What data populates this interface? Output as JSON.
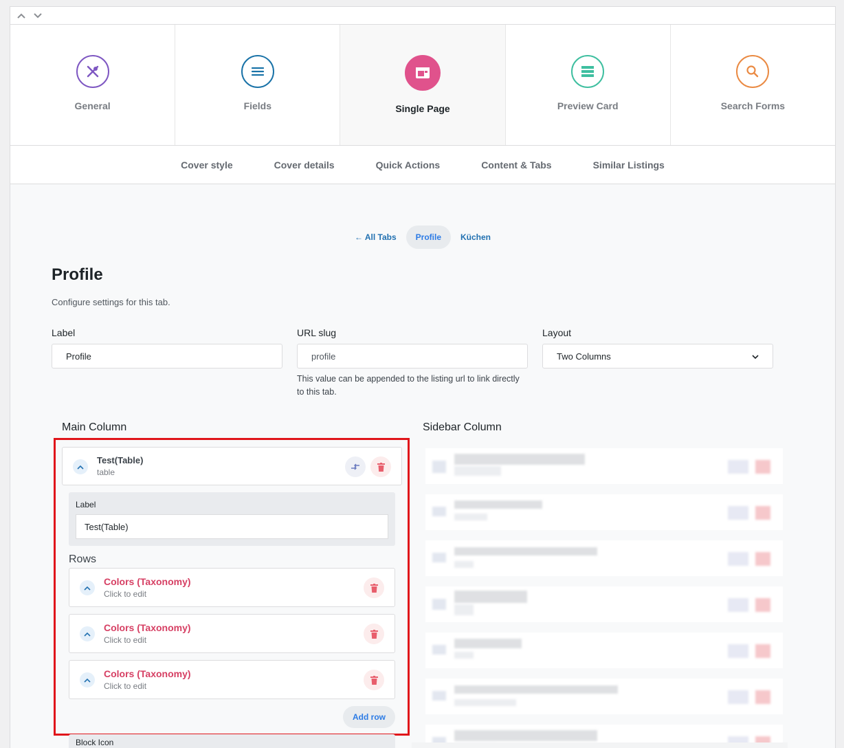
{
  "collapse_controls": {
    "up_icon": "chevron-up-icon",
    "down_icon": "chevron-down-icon"
  },
  "main_nav": [
    {
      "label": "General",
      "icon": "utensils-icon",
      "color": "#7e57c2",
      "active": false
    },
    {
      "label": "Fields",
      "icon": "list-lines-icon",
      "color": "#1a73a8",
      "active": false
    },
    {
      "label": "Single Page",
      "icon": "browser-window-icon",
      "color": "#e0528c",
      "active": true
    },
    {
      "label": "Preview Card",
      "icon": "card-icon",
      "color": "#3fbfa0",
      "active": false
    },
    {
      "label": "Search Forms",
      "icon": "search-icon",
      "color": "#ea8a43",
      "active": false
    }
  ],
  "sub_nav": [
    "Cover style",
    "Cover details",
    "Quick Actions",
    "Content & Tabs",
    "Similar Listings"
  ],
  "tab_bar": {
    "back": "← All Tabs",
    "current": "Profile",
    "next": "Küchen"
  },
  "page": {
    "title": "Profile",
    "description": "Configure settings for this tab."
  },
  "form": {
    "label_label": "Label",
    "label_value": "Profile",
    "slug_label": "URL slug",
    "slug_value": "profile",
    "slug_help": "This value can be appended to the listing url to link directly to this tab.",
    "layout_label": "Layout",
    "layout_value": "Two Columns"
  },
  "main_column": {
    "title": "Main Column",
    "block": {
      "title": "Test(Table)",
      "type": "table",
      "label_field_label": "Label",
      "label_field_value": "Test(Table)",
      "rows_title": "Rows",
      "rows": [
        {
          "title": "Colors (Taxonomy)",
          "sub": "Click to edit"
        },
        {
          "title": "Colors (Taxonomy)",
          "sub": "Click to edit"
        },
        {
          "title": "Colors (Taxonomy)",
          "sub": "Click to edit"
        }
      ],
      "add_row_label": "Add row",
      "next_field_label": "Block Icon"
    }
  },
  "sidebar_column": {
    "title": "Sidebar Column"
  },
  "colors": {
    "accent": "#2c7be5",
    "danger": "#e85e6c",
    "highlight": "#e0151a",
    "row_title": "#d63f63"
  }
}
